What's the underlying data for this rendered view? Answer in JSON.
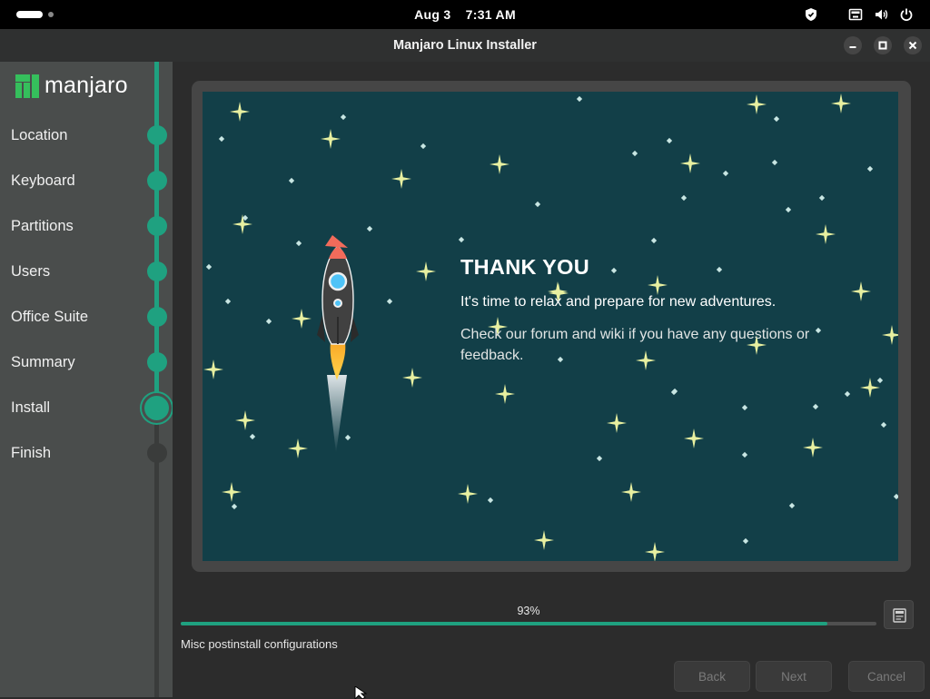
{
  "topbar": {
    "date": "Aug 3",
    "time": "7:31 AM"
  },
  "window": {
    "title": "Manjaro Linux Installer"
  },
  "sidebar": {
    "brand": "manjaro",
    "steps": [
      {
        "label": "Location",
        "state": "done"
      },
      {
        "label": "Keyboard",
        "state": "done"
      },
      {
        "label": "Partitions",
        "state": "done"
      },
      {
        "label": "Users",
        "state": "done"
      },
      {
        "label": "Office Suite",
        "state": "done"
      },
      {
        "label": "Summary",
        "state": "done"
      },
      {
        "label": "Install",
        "state": "current"
      },
      {
        "label": "Finish",
        "state": "pending"
      }
    ]
  },
  "slide": {
    "heading": "THANK YOU",
    "subheading": "It's time to relax and prepare for new adventures.",
    "body": "Check our forum and wiki if you have any questions or feedback."
  },
  "progress": {
    "label": "93%",
    "value": 0.93,
    "status": "Misc postinstall configurations"
  },
  "buttons": {
    "back": "Back",
    "next": "Next",
    "cancel": "Cancel"
  },
  "colors": {
    "accent": "#1fa180",
    "slide_background": "#123f48",
    "star": "#e8f0a0"
  },
  "icons": {
    "tray": [
      "shield-icon",
      "network-icon",
      "volume-icon",
      "power-icon"
    ],
    "window": [
      "minimize-icon",
      "maximize-icon",
      "close-icon"
    ],
    "log": "terminal-log-icon"
  }
}
